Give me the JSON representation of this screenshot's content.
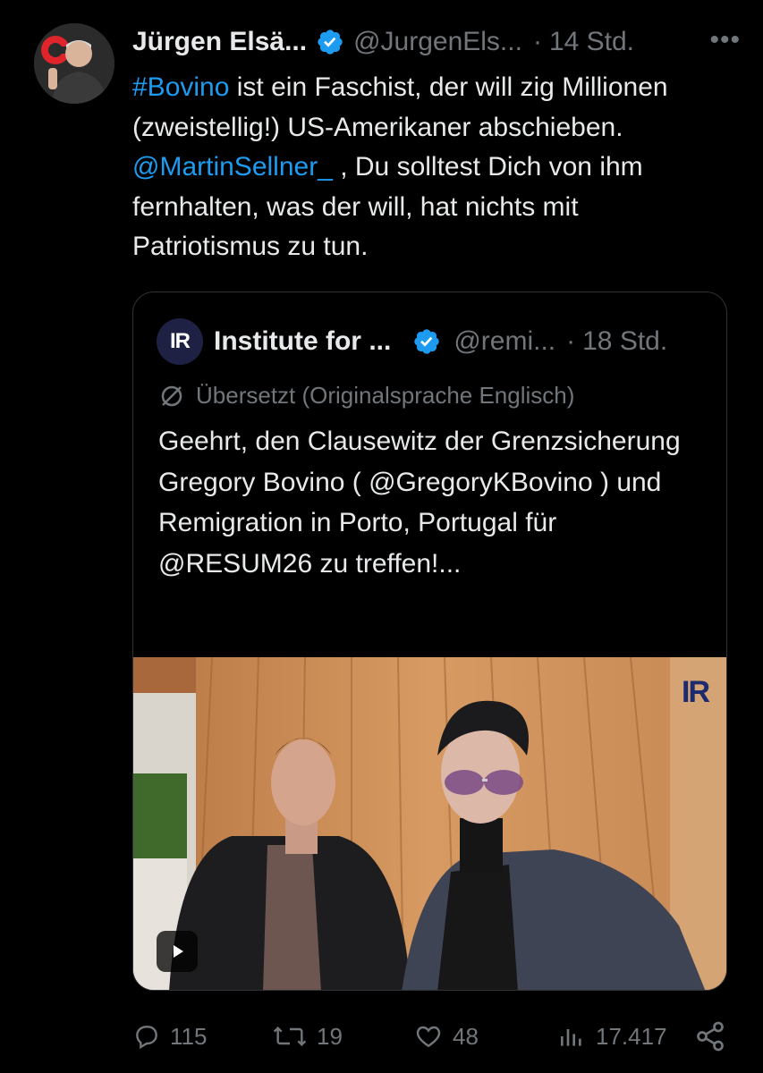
{
  "author": {
    "name": "Jürgen Elsä...",
    "handle": "@JurgenEls...",
    "separator": "·",
    "time": "14 Std."
  },
  "more_label": "•••",
  "tweet": {
    "hashtag": "#Bovino",
    "text_1": " ist ein Faschist, der will zig Millionen (zweistellig!) US-Amerikaner abschieben. ",
    "mention": "@MartinSellner_",
    "text_2": " , Du solltest Dich von ihm fernhalten, was der will, hat nichts mit Patriotismus zu tun."
  },
  "quote": {
    "avatar_text": "IR",
    "name": "Institute for ...",
    "handle": "@remi...",
    "separator": "·",
    "time": "18 Std.",
    "translated_label": "Übersetzt (Originalsprache Englisch)",
    "text": "Geehrt, den Clausewitz der Grenzsicherung Gregory Bovino ( @GregoryKBovino ) und Remigration in Porto, Portugal für @RESUM26 zu treffen!...",
    "media": {
      "watermark": "IR",
      "type": "video"
    }
  },
  "actions": {
    "replies": "115",
    "reposts": "19",
    "likes": "48",
    "views": "17.417"
  },
  "colors": {
    "background": "#000000",
    "text": "#e7e9ea",
    "secondary": "#71767b",
    "link": "#1d9bf0",
    "border": "#2f3336",
    "verified": "#1d9bf0"
  }
}
